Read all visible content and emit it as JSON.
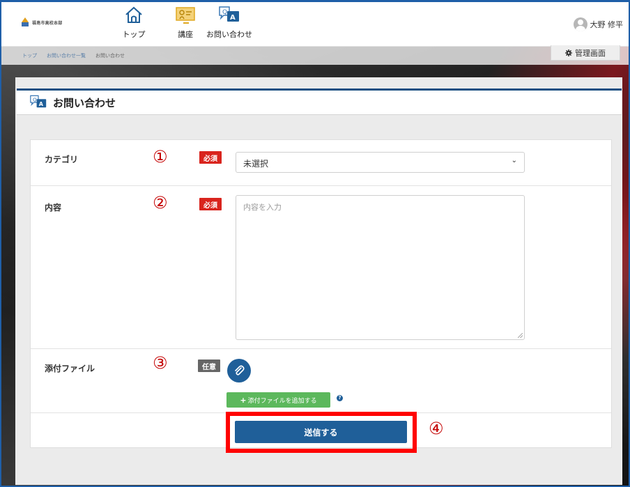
{
  "header": {
    "logo_text": "福島市高校本部",
    "nav": [
      {
        "label": "トップ",
        "icon": "home-icon"
      },
      {
        "label": "講座",
        "icon": "lecture-icon"
      },
      {
        "label": "お問い合わせ",
        "icon": "qa-icon"
      }
    ],
    "user_name": "大野 修平"
  },
  "breadcrumb": [
    "トップ",
    "お問い合わせ一覧",
    "お問い合わせ"
  ],
  "admin_button": "管理画面",
  "page_title": "お問い合わせ",
  "form": {
    "category": {
      "label": "カテゴリ",
      "marker": "①",
      "badge": "必須",
      "selected": "未選択"
    },
    "content": {
      "label": "内容",
      "marker": "②",
      "badge": "必須",
      "placeholder": "内容を入力"
    },
    "attachment": {
      "label": "添付ファイル",
      "marker": "③",
      "badge": "任意",
      "add_button": "添付ファイルを追加する"
    },
    "submit": {
      "label": "送信する",
      "marker": "④"
    }
  },
  "colors": {
    "brand_blue": "#1f5f99",
    "required_red": "#d9241d",
    "highlight_red": "#ff0000",
    "add_green": "#5cb85c"
  }
}
